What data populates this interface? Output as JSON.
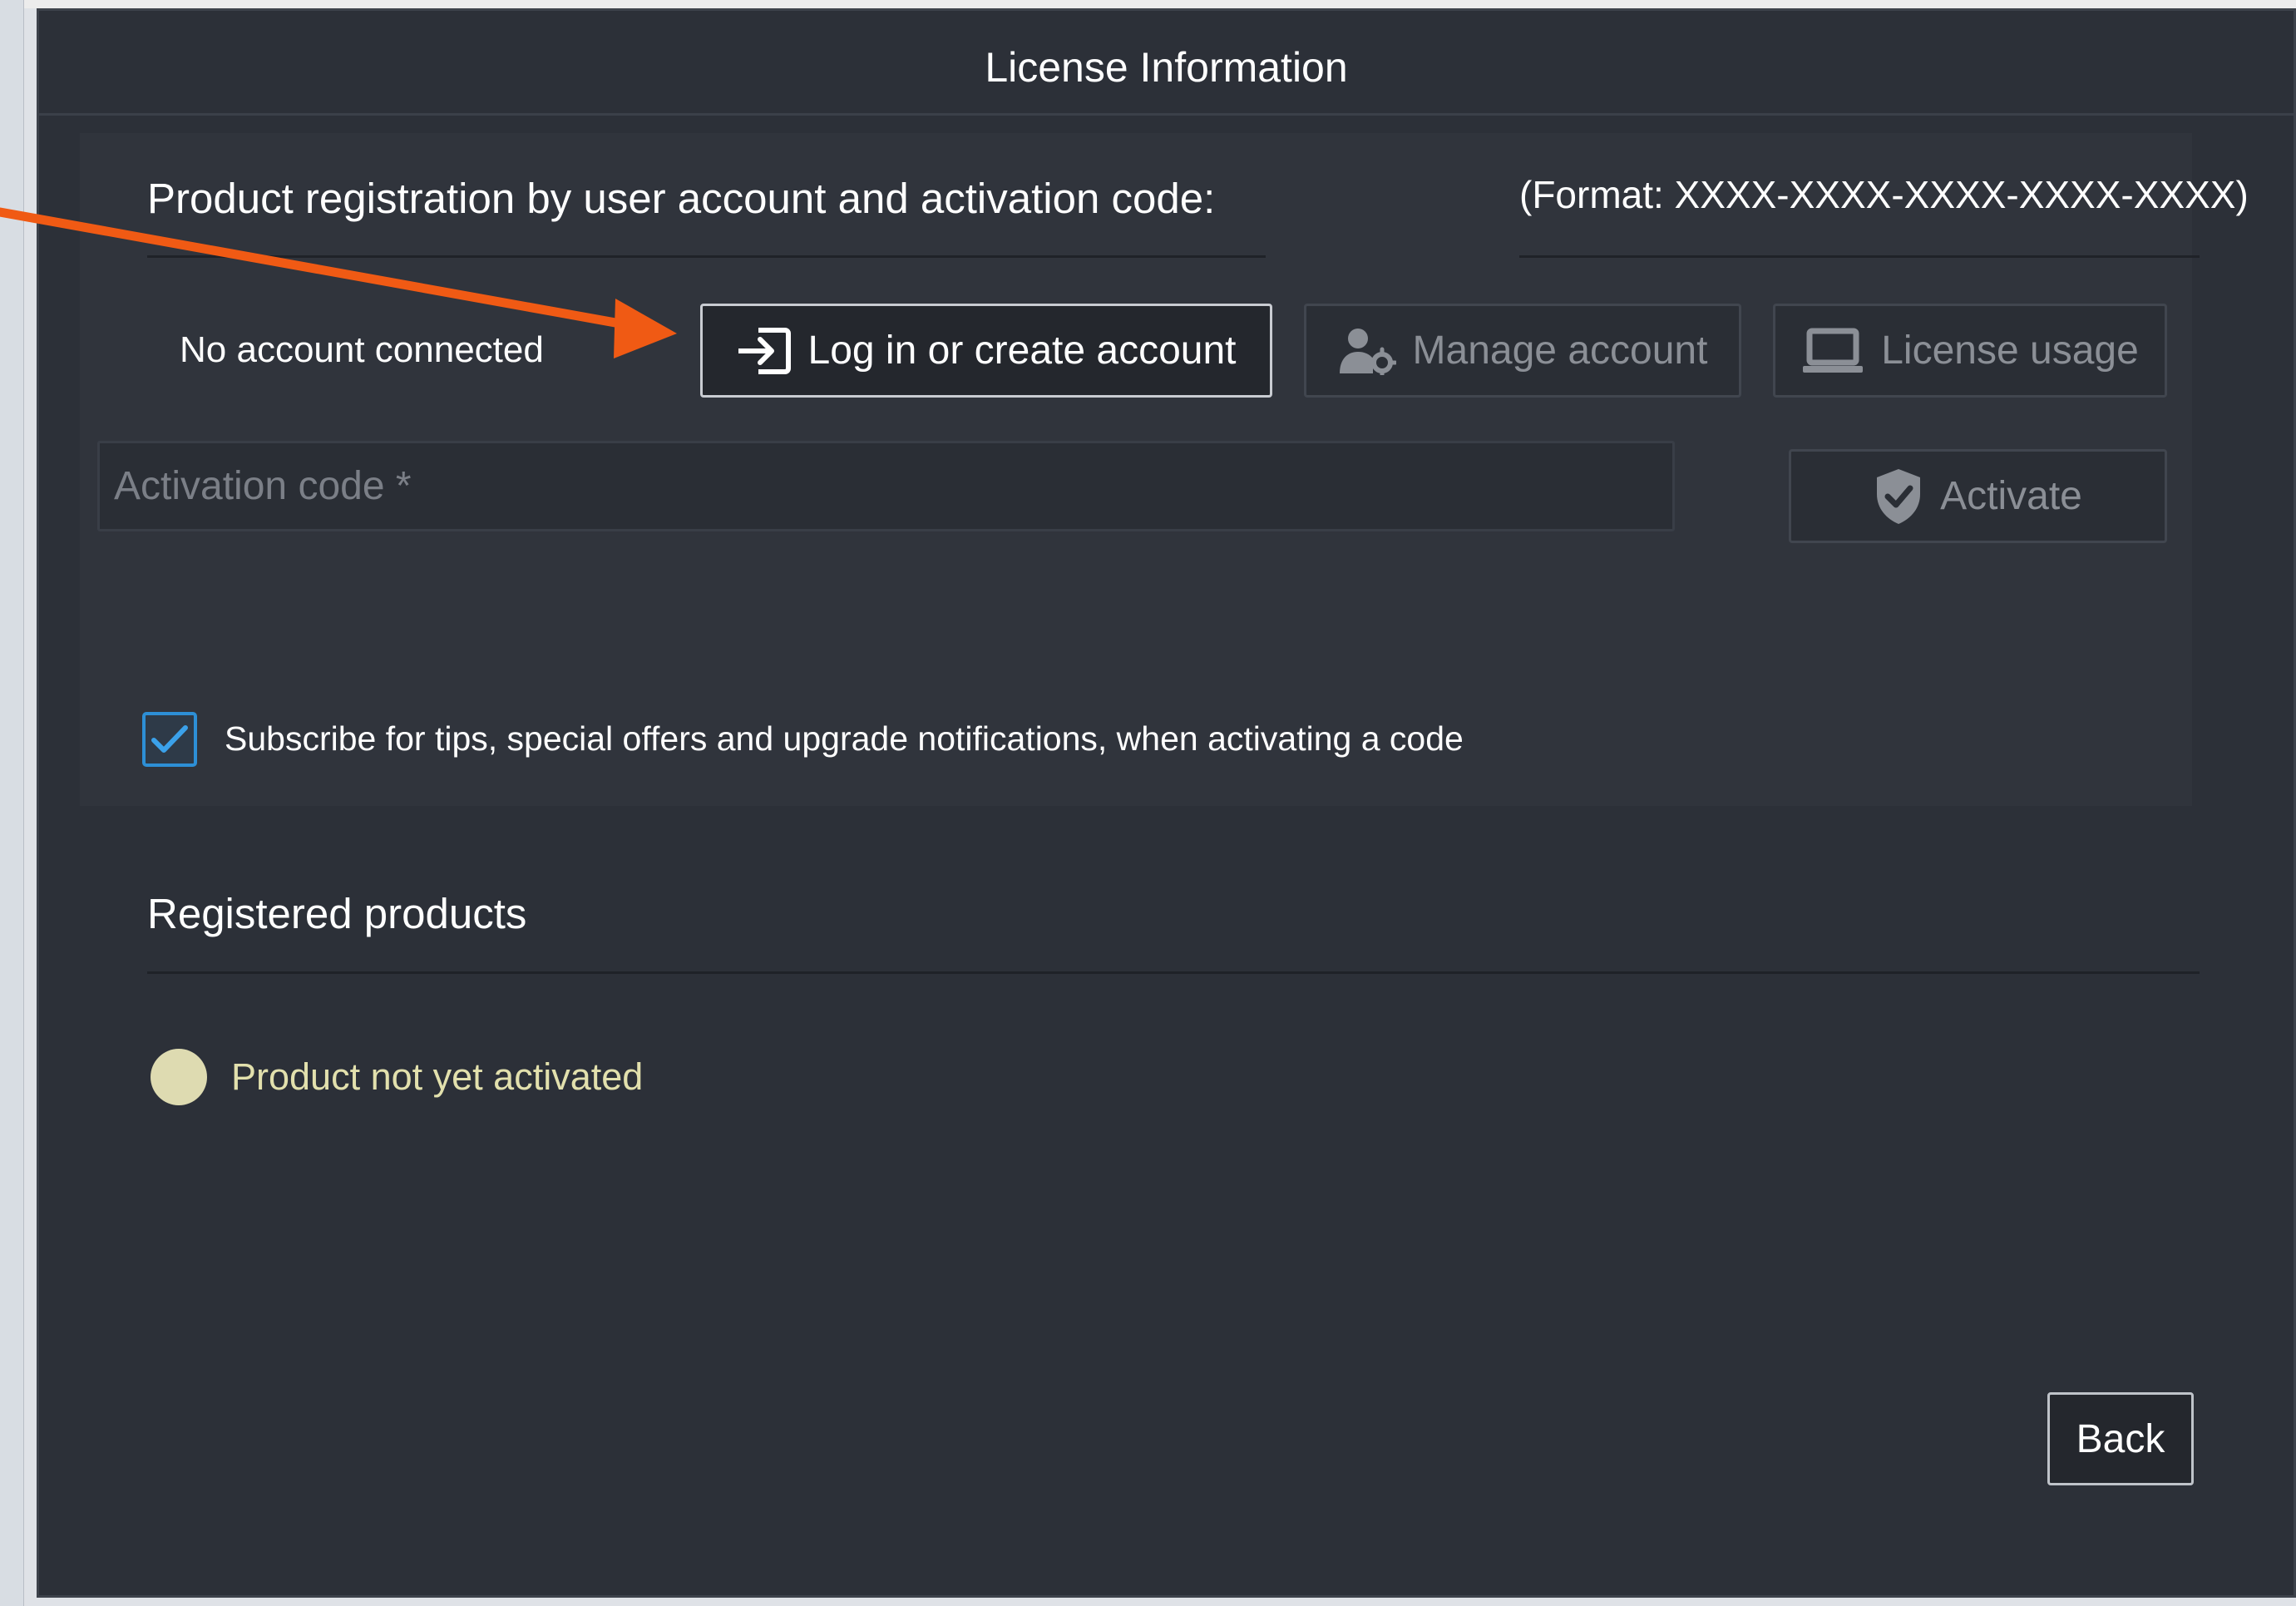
{
  "dialog": {
    "title": "License Information"
  },
  "registration": {
    "heading": "Product registration by user account and activation code:",
    "format_hint": "(Format: XXXX-XXXX-XXXX-XXXX-XXXX)",
    "account_status": "No account connected",
    "buttons": {
      "login": {
        "label": "Log in or create account",
        "icon": "login-arrow-icon",
        "enabled": true
      },
      "manage": {
        "label": "Manage account",
        "icon": "user-gear-icon",
        "enabled": false
      },
      "usage": {
        "label": "License usage",
        "icon": "laptop-icon",
        "enabled": false
      }
    },
    "activation": {
      "placeholder": "Activation code *",
      "value": "",
      "button_label": "Activate",
      "button_icon": "shield-check-icon",
      "enabled": false
    },
    "subscribe": {
      "checked": true,
      "label": "Subscribe for tips, special offers and upgrade notifications, when activating a code"
    }
  },
  "products": {
    "heading": "Registered products",
    "status_text": "Product not yet activated",
    "status_color": "#dedbb1"
  },
  "footer": {
    "back_label": "Back"
  },
  "colors": {
    "dialog_background": "#2c3038",
    "panel_background": "#30343c",
    "annotation_arrow": "#f05a14",
    "checkbox_accent": "#2d8fd6"
  }
}
